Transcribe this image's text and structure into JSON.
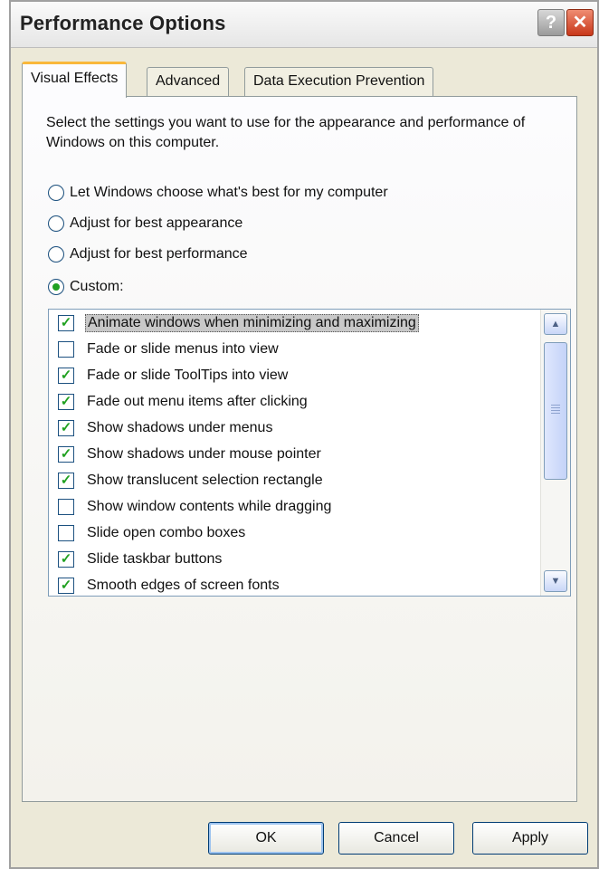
{
  "window": {
    "title": "Performance Options",
    "help_label": "?",
    "close_label": "✕"
  },
  "tabs": [
    {
      "label": "Visual Effects",
      "active": true
    },
    {
      "label": "Advanced",
      "active": false
    },
    {
      "label": "Data Execution Prevention",
      "active": false
    }
  ],
  "description": "Select the settings you want to use for the appearance and performance of Windows on this computer.",
  "radios": [
    {
      "label": "Let Windows choose what's best for my computer",
      "selected": false
    },
    {
      "label": "Adjust for best appearance",
      "selected": false
    },
    {
      "label": "Adjust for best performance",
      "selected": false
    },
    {
      "label": "Custom:",
      "selected": true
    }
  ],
  "effects": [
    {
      "label": "Animate windows when minimizing and maximizing",
      "checked": true,
      "selected": true
    },
    {
      "label": "Fade or slide menus into view",
      "checked": false
    },
    {
      "label": "Fade or slide ToolTips into view",
      "checked": true
    },
    {
      "label": "Fade out menu items after clicking",
      "checked": true
    },
    {
      "label": "Show shadows under menus",
      "checked": true
    },
    {
      "label": "Show shadows under mouse pointer",
      "checked": true
    },
    {
      "label": "Show translucent selection rectangle",
      "checked": true
    },
    {
      "label": "Show window contents while dragging",
      "checked": false
    },
    {
      "label": "Slide open combo boxes",
      "checked": false
    },
    {
      "label": "Slide taskbar buttons",
      "checked": true
    },
    {
      "label": "Smooth edges of screen fonts",
      "checked": true
    }
  ],
  "scrollbar": {
    "up_icon": "▲",
    "down_icon": "▼"
  },
  "buttons": {
    "ok": "OK",
    "cancel": "Cancel",
    "apply": "Apply"
  },
  "colors": {
    "accent_tab": "#f9b83b",
    "check": "#21a121",
    "close": "#c8371a"
  }
}
